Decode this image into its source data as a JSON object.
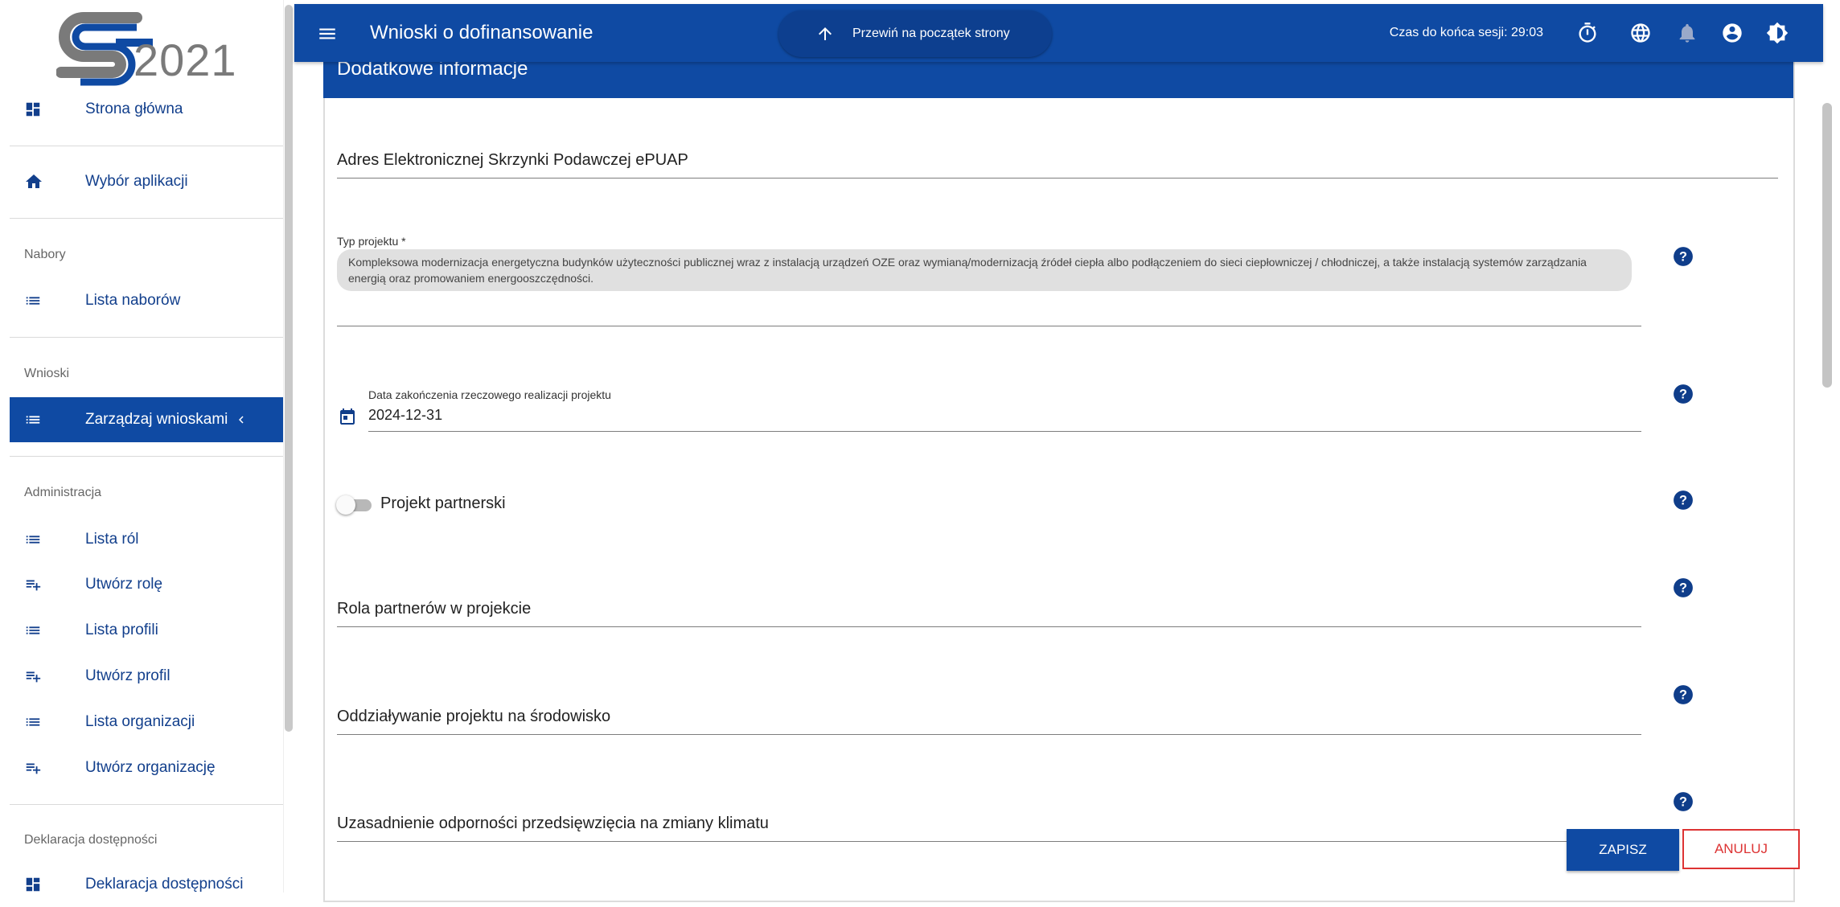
{
  "logo": {
    "text": "2021"
  },
  "sidebar": {
    "items": [
      {
        "label": "Strona główna",
        "icon": "dashboard-icon"
      },
      {
        "label": "Wybór aplikacji",
        "icon": "home-icon"
      },
      {
        "label": "Lista naborów",
        "icon": "list-icon"
      },
      {
        "label": "Zarządzaj wnioskami",
        "icon": "list-icon",
        "active": true
      },
      {
        "label": "Lista ról",
        "icon": "list-icon"
      },
      {
        "label": "Utwórz rolę",
        "icon": "playlist-add-icon"
      },
      {
        "label": "Lista profili",
        "icon": "list-icon"
      },
      {
        "label": "Utwórz profil",
        "icon": "playlist-add-icon"
      },
      {
        "label": "Lista organizacji",
        "icon": "list-icon"
      },
      {
        "label": "Utwórz organizację",
        "icon": "playlist-add-icon"
      },
      {
        "label": "Deklaracja dostępności",
        "icon": "dashboard-icon"
      }
    ],
    "sections": [
      "Nabory",
      "Wnioski",
      "Administracja",
      "Deklaracja dostępności"
    ]
  },
  "topbar": {
    "title": "Wnioski o dofinansowanie",
    "scroll_top_label": "Przewiń na początek strony",
    "session": "Czas do końca sesji: 29:03"
  },
  "form": {
    "section_title": "Dodatkowe informacje",
    "epuap_label": "Adres Elektronicznej Skrzynki Podawczej ePUAP",
    "project_type_label": "Typ projektu *",
    "project_type_value": "Kompleksowa modernizacja energetyczna budynków użyteczności publicznej wraz z instalacją urządzeń OZE oraz wymianą/modernizacją źródeł ciepła albo podłączeniem do sieci ciepłowniczej / chłodniczej, a także instalacją systemów zarządzania energią oraz promowaniem energooszczędności.",
    "end_date_label": "Data zakończenia rzeczowego realizacji projektu",
    "end_date_value": "2024-12-31",
    "partner_label": "Projekt partnerski",
    "partner_checked": false,
    "partner_role_label": "Rola partnerów w projekcie",
    "environment_label": "Oddziaływanie projektu na środowisko",
    "climate_label": "Uzasadnienie odporności przedsięwzięcia na zmiany klimatu"
  },
  "actions": {
    "save": "ZAPISZ",
    "cancel": "ANULUJ"
  },
  "colors": {
    "primary": "#0f4aa3",
    "danger": "#d33333"
  }
}
